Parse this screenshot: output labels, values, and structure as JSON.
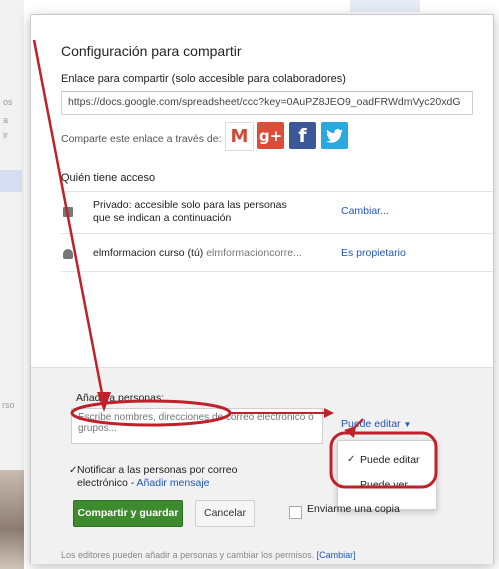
{
  "background": {
    "left_texts": [
      "os",
      "a",
      "ir",
      "rso"
    ]
  },
  "dialog": {
    "title": "Configuración para compartir",
    "link_label": "Enlace para compartir (solo accesible para colaboradores)",
    "link_value": "https://docs.google.com/spreadsheet/ccc?key=0AuPZ8JEO9_oadFRWdmVyc20xdG",
    "share_via_label": "Comparte este enlace a través de:",
    "social": [
      {
        "name": "gmail-icon",
        "glyph": "M"
      },
      {
        "name": "google-plus-icon",
        "glyph": "g+"
      },
      {
        "name": "facebook-icon",
        "glyph": "f"
      },
      {
        "name": "twitter-icon",
        "glyph": "t"
      }
    ],
    "access_heading": "Quién tiene acceso",
    "access_rows": [
      {
        "icon": "lock-icon",
        "line1": "Privado: accesible solo para las personas",
        "line2": "que se indican a continuación",
        "action": "Cambiar..."
      },
      {
        "icon": "person-icon",
        "line1": "elmformacion curso (tú)",
        "sub": "elmformacioncorre...",
        "action": "Es propietario"
      }
    ],
    "add_people": {
      "label": "Añadir a personas:",
      "placeholder": "Escribe nombres, direcciones de correo electrónico o grupos...",
      "permission_label": "Puede editar",
      "permission_options": [
        "Puede editar",
        "Puede ver"
      ],
      "selected_option": "Puede editar",
      "notify_label": "Notificar a las personas por correo",
      "notify_label2": "electrónico -",
      "add_message_link": "Añadir mensaje",
      "share_save_button": "Compartir y guardar",
      "cancel_button": "Cancelar",
      "send_copy_label": "Enviarme una copia"
    },
    "footer_text": "Los editores pueden añadir a personas y cambiar los permisos.",
    "footer_link": "[Cambiar]"
  },
  "colors": {
    "primary_button": "#3d8b2e",
    "link": "#2058b8",
    "annotation": "#c0202a"
  }
}
